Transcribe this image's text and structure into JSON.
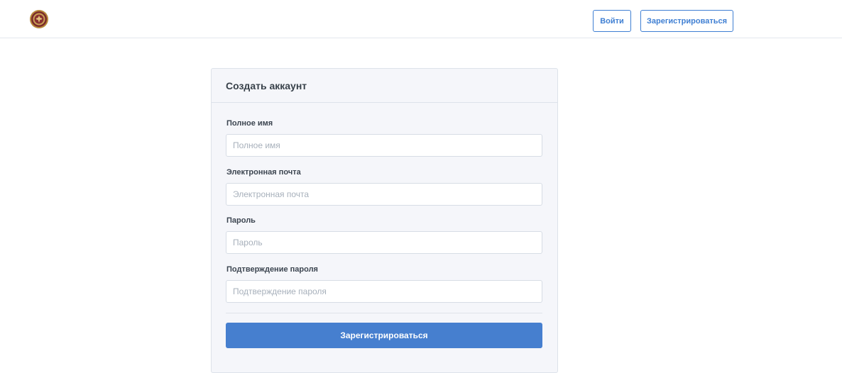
{
  "header": {
    "logo_icon": "seal-logo-icon",
    "login_label": "Войти",
    "register_label": "Зарегистрироваться"
  },
  "colors": {
    "accent": "#467fcf",
    "card_bg": "#f5f6fa",
    "border": "#dde2ea"
  },
  "form": {
    "title": "Создать аккаунт",
    "fields": [
      {
        "label": "Полное имя",
        "placeholder": "Полное имя",
        "value": ""
      },
      {
        "label": "Электронная почта",
        "placeholder": "Электронная почта",
        "value": ""
      },
      {
        "label": "Пароль",
        "placeholder": "Пароль",
        "value": ""
      },
      {
        "label": "Подтверждение пароля",
        "placeholder": "Подтверждение пароля",
        "value": ""
      }
    ],
    "submit_label": "Зарегистрироваться"
  }
}
